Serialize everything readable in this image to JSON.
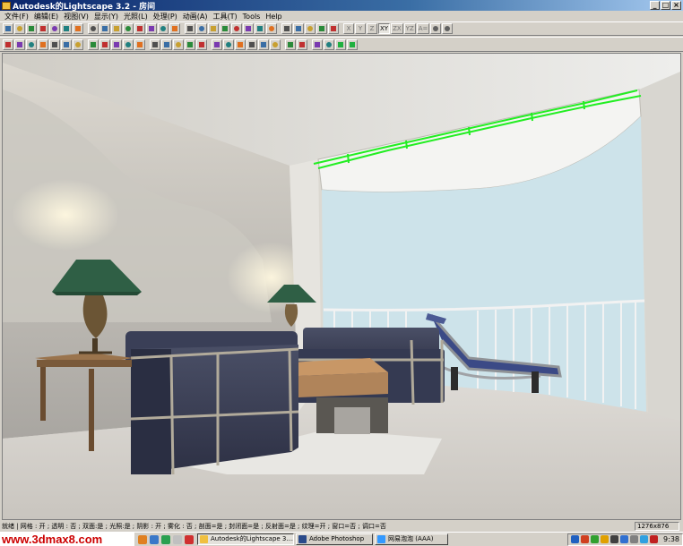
{
  "window": {
    "title": "Autodesk的Lightscape 3.2 - 房间",
    "controls": [
      "_",
      "□",
      "×"
    ]
  },
  "menu": [
    "文件(F)",
    "编辑(E)",
    "视图(V)",
    "显示(Y)",
    "光照(L)",
    "处理(P)",
    "动画(A)",
    "工具(T)",
    "Tools",
    "Help"
  ],
  "toolbar1": {
    "icons": [
      "new-icon",
      "open-icon",
      "save-icon",
      "save-as-icon",
      "print-icon",
      "help-icon",
      "context-help-icon",
      "select-icon",
      "arrow-icon",
      "copy-icon",
      "paste-icon",
      "layer-icon",
      "material-icon",
      "light-icon",
      "block-icon",
      "rotate-icon",
      "orbit-icon",
      "walk-icon",
      "zoom-icon",
      "pan-icon",
      "dolly-icon",
      "camera-icon",
      "wireframe-icon",
      "refresh-icon",
      "zoom-in-icon",
      "fit-icon",
      "undo-view-icon",
      "redo-view-icon"
    ],
    "axis_buttons": [
      "X",
      "Y",
      "Z",
      "XY",
      "ZX",
      "YZ",
      "A="
    ],
    "active_axis": "XY"
  },
  "toolbar2": {
    "icons": [
      "display-mode-icon",
      "radiosity-icon",
      "sphere-icon",
      "render-icon",
      "shade-icon",
      "texture-icon",
      "outline-icon",
      "light-source-icon",
      "walkthrough-icon",
      "run-icon",
      "person-icon",
      "cross-icon",
      "pointer-icon",
      "pick-icon",
      "orbit-tool-icon",
      "zoom-tool-icon",
      "pan-tool-icon",
      "mesh-icon",
      "surface-icon",
      "surface-select-icon",
      "copy-surface-icon",
      "paste-surface-icon",
      "edit-icon",
      "flag-icon",
      "rotate-tool-icon",
      "sun-icon",
      "sky-icon",
      "box-icon",
      "green-cube-icon"
    ]
  },
  "status": {
    "text": "就绪 | 网格 : 开 ; 透明 : 否 ; 双面:是 ; 光照:是 ; 阴影 : 开 ; 雾化 : 否 ; 剖面=是 ; 封闭面=是 ; 反射面=是 ; 纹理=开 ; 窗口=否 ; 调口=否",
    "resolution": "1276x876"
  },
  "taskbar": {
    "watermark": "www.3dmax8.com",
    "tasks": [
      {
        "label": "Autodesk的Lightscape 3....",
        "color": "#f0c040",
        "active": true
      },
      {
        "label": "Adobe Photoshop",
        "color": "#2a4a8a",
        "active": false
      },
      {
        "label": "网易泡泡 (AAA)",
        "color": "#3399ff",
        "active": false
      }
    ],
    "quick_launch_colors": [
      "#e08020",
      "#3a78c8",
      "#2aa050",
      "#c0c0c0",
      "#d03030"
    ],
    "tray_colors": [
      "#2060c0",
      "#d04020",
      "#30a030",
      "#e0a000",
      "#404040",
      "#3070d0",
      "#808080",
      "#30a0e0",
      "#c02020"
    ],
    "clock": "9:38"
  },
  "colors": {
    "title_start": "#0a246a",
    "title_end": "#a6caf0",
    "chrome": "#d4d0c8",
    "selection_outline": "#22ee22",
    "sky": "#cde3ea"
  }
}
